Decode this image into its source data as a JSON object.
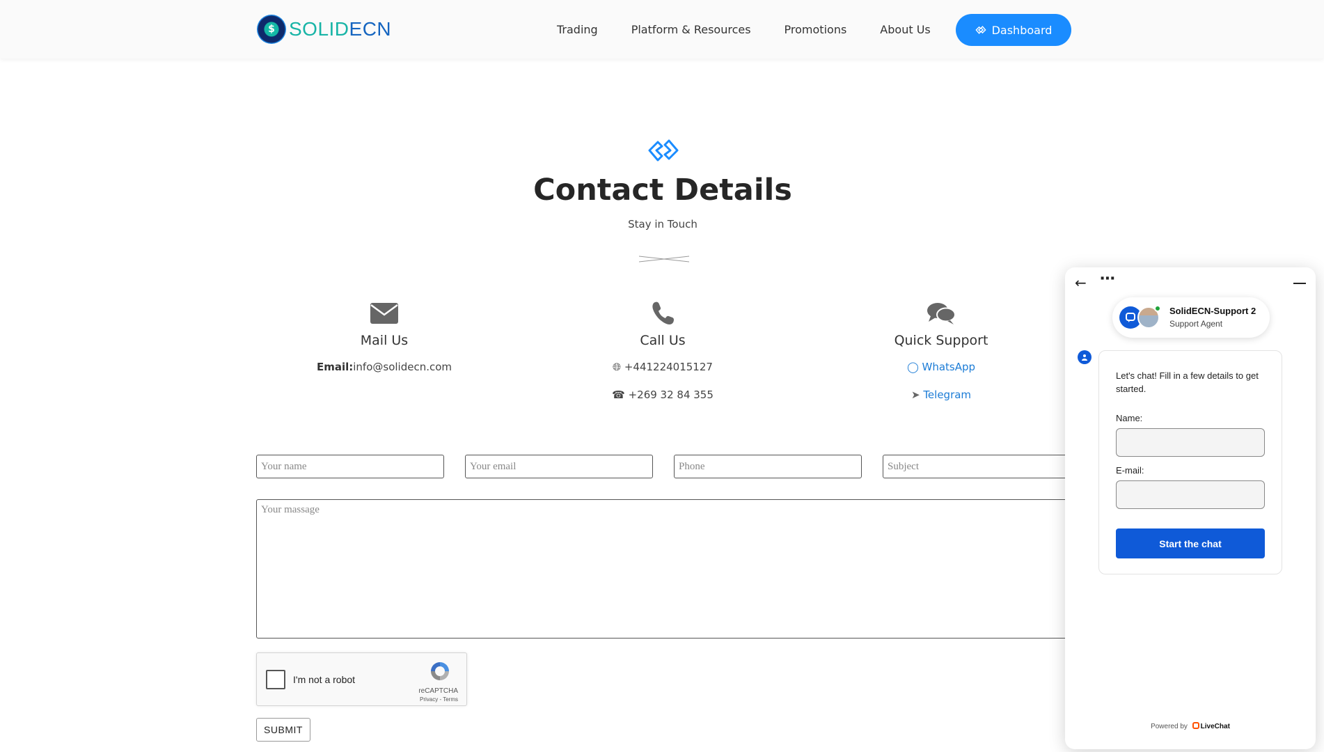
{
  "header": {
    "logo": {
      "part1": "SOLID",
      "part2": "ECN"
    },
    "nav": [
      "Trading",
      "Platform & Resources",
      "Promotions",
      "About Us"
    ],
    "dashboard_label": "Dashboard"
  },
  "section": {
    "title": "Contact Details",
    "subtitle": "Stay in Touch"
  },
  "contacts": {
    "mail": {
      "title": "Mail Us",
      "label": "Email:",
      "email": "info@solidecn.com"
    },
    "call": {
      "title": "Call Us",
      "phone1": "+441224015127",
      "phone2": "+269 32 84 355"
    },
    "support": {
      "title": "Quick Support",
      "whatsapp": "WhatsApp",
      "telegram": "Telegram"
    }
  },
  "form": {
    "name_placeholder": "Your name",
    "email_placeholder": "Your email",
    "phone_placeholder": "Phone",
    "subject_placeholder": "Subject",
    "message_placeholder": "Your massage",
    "captcha_label": "I'm not a robot",
    "captcha_brand": "reCAPTCHA",
    "captcha_terms": "Privacy - Terms",
    "submit_label": "SUBMIT"
  },
  "chat": {
    "agent_name": "SolidECN-Support 2",
    "agent_role": "Support Agent",
    "intro": "Let's chat! Fill in a few details to get started.",
    "name_label": "Name:",
    "email_label": "E-mail:",
    "start_label": "Start the chat",
    "powered_prefix": "Powered by",
    "powered_brand": "LiveChat"
  },
  "colors": {
    "accent": "#1a8cff",
    "link": "#1c7cd6",
    "chat_primary": "#0f5ad8",
    "online": "#1fa33a"
  },
  "icons": [
    "dashboard-icon",
    "section-diamond-icon",
    "mail-icon",
    "phone-icon",
    "chat-bubbles-icon",
    "globe-icon",
    "whatsapp-icon",
    "telegram-icon",
    "recaptcha-icon",
    "back-arrow-icon",
    "more-icon",
    "minimize-icon"
  ]
}
